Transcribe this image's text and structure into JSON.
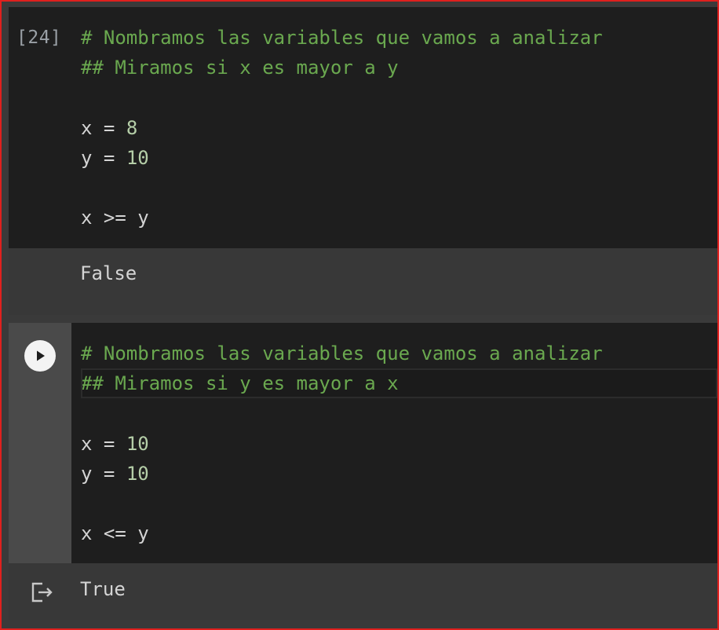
{
  "cell1": {
    "execution_count": "[24]",
    "code_lines": [
      {
        "text": "# Nombramos las variables que vamos a analizar",
        "kind": "comment"
      },
      {
        "text": "## Miramos si x es mayor a y",
        "kind": "comment"
      },
      {
        "text": "",
        "kind": "blank"
      },
      {
        "var": "x",
        "op": " = ",
        "num": "8",
        "kind": "assign"
      },
      {
        "var": "y",
        "op": " = ",
        "num": "10",
        "kind": "assign"
      },
      {
        "text": "",
        "kind": "blank"
      },
      {
        "text": "x >= y",
        "kind": "expr"
      }
    ],
    "output": "False"
  },
  "cell2": {
    "run_icon": "play-icon",
    "output_icon": "clear-output-icon",
    "code_lines": [
      {
        "text": "# Nombramos las variables que vamos a analizar",
        "kind": "comment"
      },
      {
        "text": "## Miramos si y es mayor a x",
        "kind": "comment"
      },
      {
        "text": "",
        "kind": "blank"
      },
      {
        "var": "x",
        "op": " = ",
        "num": "10",
        "kind": "assign"
      },
      {
        "var": "y",
        "op": " = ",
        "num": "10",
        "kind": "assign"
      },
      {
        "text": "",
        "kind": "blank"
      },
      {
        "text": "x <= y",
        "kind": "expr"
      }
    ],
    "output": "True"
  },
  "colors": {
    "comment": "#6aa84f",
    "number": "#b5cea8",
    "code_bg": "#1e1e1e",
    "output_bg": "#383838",
    "border": "#e0201e"
  }
}
